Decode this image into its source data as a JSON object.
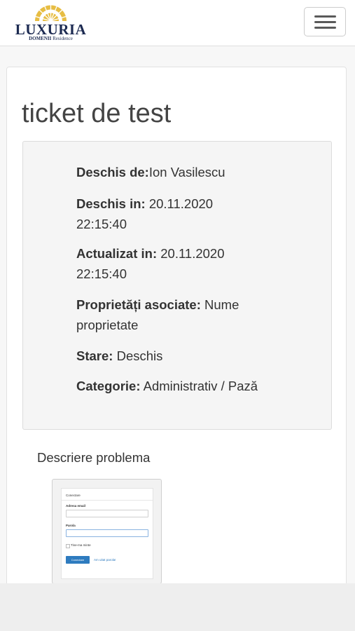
{
  "brand": {
    "name": "LUXURIA",
    "subtitle_bold": "DOMENII",
    "subtitle_rest": "Residence",
    "colors": {
      "navy": "#1d2b52",
      "gold": "#e0b53a"
    }
  },
  "navbar": {
    "toggle_icon": "hamburger-menu-icon"
  },
  "ticket": {
    "title": "ticket de test",
    "opened_by_label": "Deschis de:",
    "opened_by_value": "Ion Vasilescu",
    "opened_at_label": "Deschis in:",
    "opened_at_date": "20.11.2020",
    "opened_at_time": "22:15:40",
    "updated_at_label": "Actualizat in:",
    "updated_at_date": "20.11.2020",
    "updated_at_time": "22:15:40",
    "properties_label": "Proprietăți asociate:",
    "properties_value_1": "Nume",
    "properties_value_2": "proprietate",
    "status_label": "Stare:",
    "status_value": "Deschis",
    "category_label": "Categorie:",
    "category_value": "Administrativ / Pază"
  },
  "description": {
    "heading": "Descriere problema",
    "attachment": {
      "panel_title": "Conectare",
      "email_label": "Adresa email",
      "password_label": "Parola",
      "remember_label": "Tine-ma minte",
      "login_button": "Conectare",
      "forgot_link": "Am uitat parola!"
    }
  }
}
